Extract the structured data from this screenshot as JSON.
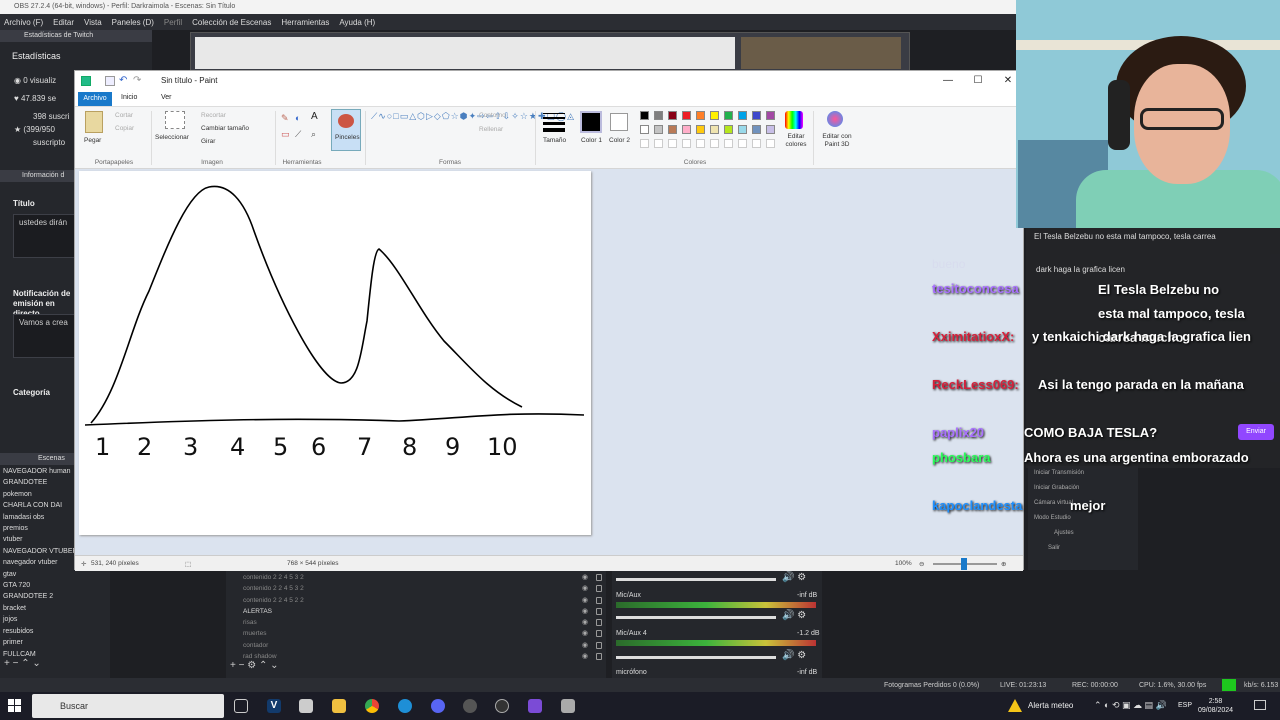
{
  "obs": {
    "title": "OBS 27.2.4 (64-bit, windows) - Perfil: Darkraimola - Escenas: Sin Título",
    "menu": [
      "Archivo (F)",
      "Editar",
      "Vista",
      "Paneles (D)",
      "Perfil",
      "Colección de Escenas",
      "Herramientas",
      "Ayuda (H)"
    ],
    "stats_title": "Estadísticas de Twitch",
    "stats_label": "Estadísticas",
    "stats": [
      "0 visualiz",
      "47.839 se",
      "398 suscri",
      "(399/950",
      "suscripto"
    ],
    "info_title": "Información d",
    "titulo_label": "Título",
    "titulo_value": "ustedes dirán",
    "notif_label": "Notificación de emisión en directo",
    "notif_value": "Vamos a crea",
    "categoria_label": "Categoría",
    "scenes_title": "Escenas",
    "scenes": [
      "NAVEGADOR human",
      "GRANDOTEE",
      "pokemon",
      "CHARLA CON DAI",
      "lamadasi obs",
      "premios",
      "vtuber",
      "NAVEGADOR VTUBER",
      "navegador vtuber",
      "gtav",
      "GTA 720",
      "GRANDOTEE 2",
      "bracket",
      "jojos",
      "resubidos",
      "primer",
      "FULLCAM"
    ],
    "sources": [
      "contenido 2 2 4 5 3 2",
      "contenido 2 2 4 5 3 2",
      "contenido 2 2 4 5 2 2",
      "ALERTAS",
      "risas",
      "muertes",
      "contador",
      "rad shadow"
    ],
    "mixer": {
      "mic1": "Mic/Aux",
      "mic2": "Mic/Aux 4",
      "mic3": "micrófono",
      "db1": "-inf dB",
      "db2": "-1.2 dB",
      "db3": "-inf dB"
    },
    "controls": [
      "Iniciar Transmisión",
      "Iniciar Grabación",
      "Cámara virtual",
      "Modo Estudio",
      "Ajustes",
      "Salir"
    ],
    "status": {
      "frames": "Fotogramas Perdidos 0 (0.0%)",
      "live": "LIVE: 01:23:13",
      "rec": "REC: 00:00:00",
      "cpu": "CPU: 1.6%, 30.00 fps",
      "kbps": "kb/s: 6.153"
    }
  },
  "paint": {
    "title": "Sin título - Paint",
    "tabs": {
      "archivo": "Archivo",
      "inicio": "Inicio",
      "ver": "Ver"
    },
    "ribbon": {
      "pegar": "Pegar",
      "cortar": "Cortar",
      "copiar": "Copiar",
      "seleccionar": "Seleccionar",
      "recortar": "Recortar",
      "cambiar_tamano": "Cambiar tamaño",
      "girar": "Girar",
      "pinceles": "Pinceles",
      "contorno": "Contorno",
      "rellenar": "Rellenar",
      "tamano": "Tamaño",
      "color1": "Color 1",
      "color2": "Color 2",
      "editar_colores": "Editar colores",
      "editar_paint3d": "Editar con Paint 3D",
      "groups": {
        "portapapeles": "Portapapeles",
        "imagen": "Imagen",
        "herramientas": "Herramientas",
        "formas": "Formas",
        "colores": "Colores"
      }
    },
    "palette": [
      "#000000",
      "#7f7f7f",
      "#880015",
      "#ed1c24",
      "#ff7f27",
      "#fff200",
      "#22b14c",
      "#00a2e8",
      "#3f48cc",
      "#a349a4",
      "#ffffff",
      "#c3c3c3",
      "#b97a57",
      "#ffaec9",
      "#ffc90e",
      "#efe4b0",
      "#b5e61d",
      "#99d9ea",
      "#7092be",
      "#c8bfe7"
    ],
    "status": {
      "cursor": "531, 240 píxeles",
      "size": "768 × 544 píxeles",
      "zoom": "100%"
    },
    "canvas_labels": [
      "1",
      "2",
      "3",
      "4",
      "5",
      "6",
      "7",
      "8",
      "9",
      "10"
    ]
  },
  "chat": {
    "messages": [
      {
        "user": "",
        "text": "bueno",
        "faint": true
      },
      {
        "user": "tesitoconcesa",
        "text": "El Tesla Belzebu no esta mal tampoco, tesla carrea mucho"
      },
      {
        "user": "XximitatioxX:",
        "text": "y tenkaichi dark haga la grafica lien"
      },
      {
        "user": "ReckLess069:",
        "text": "Asi la tengo parada en la mañana"
      },
      {
        "user": "paplix20",
        "text": "COMO BAJA TESLA?"
      },
      {
        "user": "phosbara",
        "text": "Ahora es una argentina emborazado"
      },
      {
        "user": "kapoclandesta",
        "text": "mejor"
      }
    ],
    "top_message": "El Tesla Belzebu no esta mal tampoco, tesla carrea",
    "top_message2": "dark haga la grafica licen",
    "send_label": "Enviar"
  },
  "taskbar": {
    "search_placeholder": "Buscar",
    "weather": "Alerta meteo",
    "lang": "ESP",
    "time": "2:58",
    "date": "09/08/2024"
  }
}
